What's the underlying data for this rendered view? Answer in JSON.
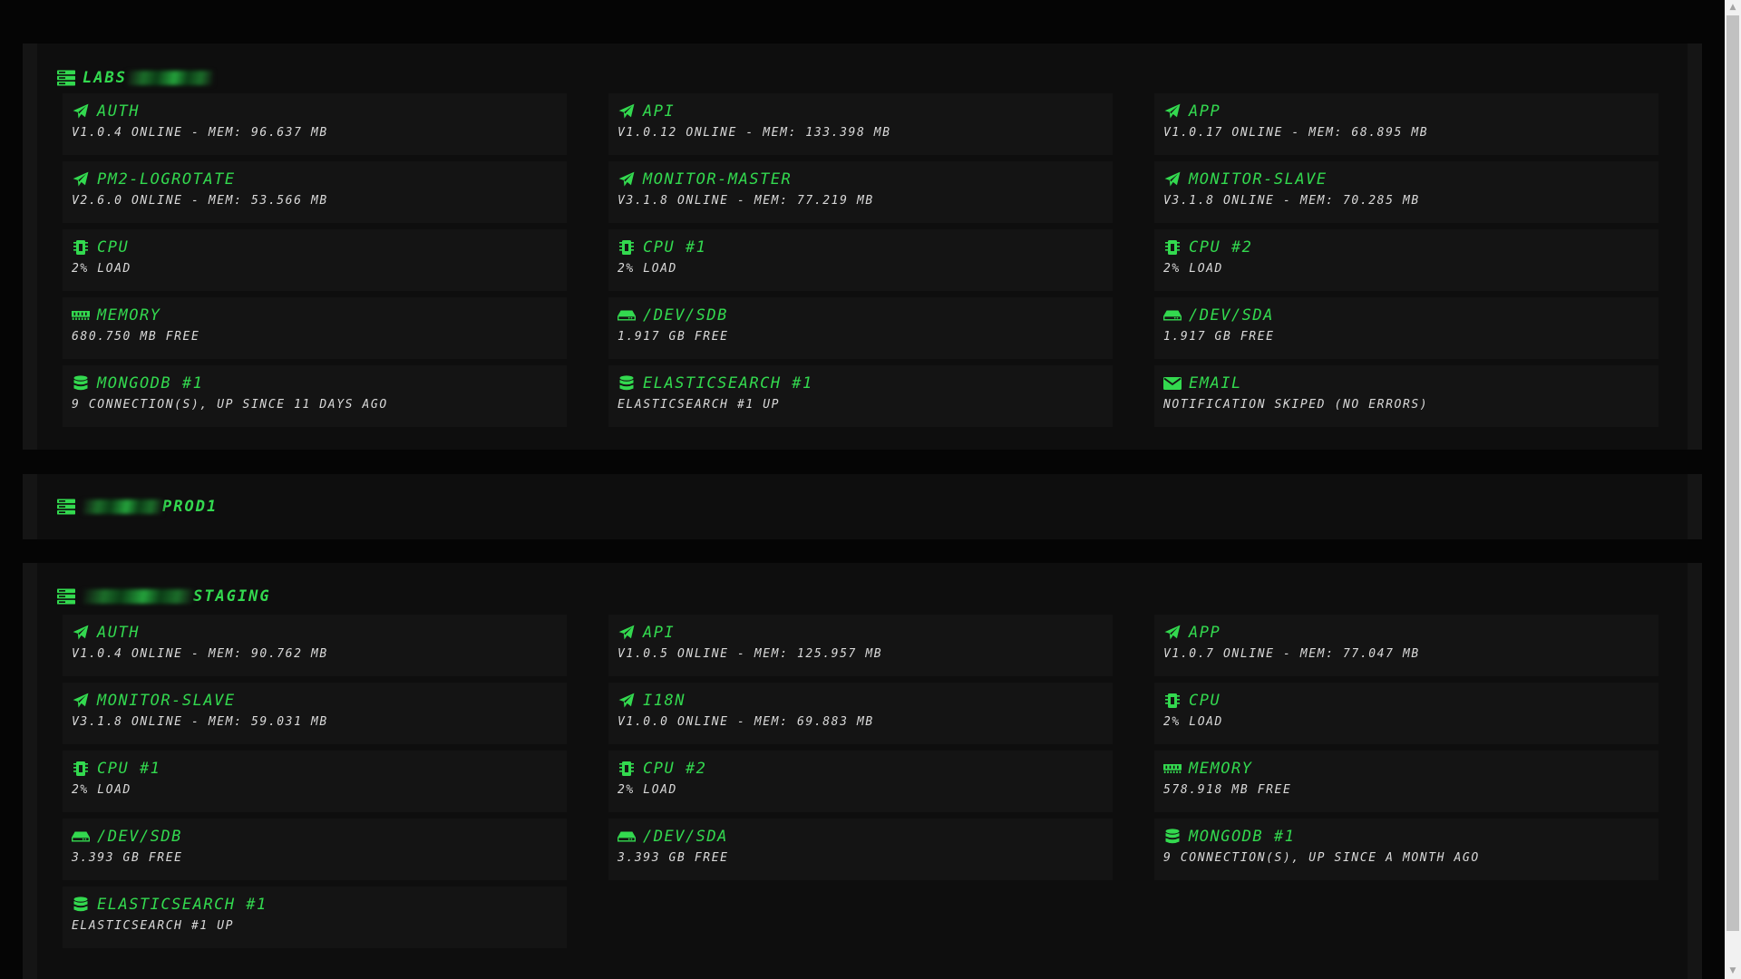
{
  "colors": {
    "accent": "#33d94f",
    "background": "#050505",
    "panel": "#0e0e0e",
    "tile": "#141414",
    "text": "#d9d9d9"
  },
  "groups": [
    {
      "name": "LABS",
      "name_position": "suffix",
      "tiles": [
        {
          "icon": "send-icon",
          "title": "AUTH",
          "subtitle": "V1.0.4 ONLINE - MEM: 96.637 MB"
        },
        {
          "icon": "send-icon",
          "title": "API",
          "subtitle": "V1.0.12 ONLINE - MEM: 133.398 MB"
        },
        {
          "icon": "send-icon",
          "title": "APP",
          "subtitle": "V1.0.17 ONLINE - MEM: 68.895 MB"
        },
        {
          "icon": "send-icon",
          "title": "PM2-LOGROTATE",
          "subtitle": "V2.6.0 ONLINE - MEM: 53.566 MB"
        },
        {
          "icon": "send-icon",
          "title": "MONITOR-MASTER",
          "subtitle": "V3.1.8 ONLINE - MEM: 77.219 MB"
        },
        {
          "icon": "send-icon",
          "title": "MONITOR-SLAVE",
          "subtitle": "V3.1.8 ONLINE - MEM: 70.285 MB"
        },
        {
          "icon": "cpu-icon",
          "title": "CPU",
          "subtitle": "2% LOAD"
        },
        {
          "icon": "cpu-icon",
          "title": "CPU #1",
          "subtitle": "2% LOAD"
        },
        {
          "icon": "cpu-icon",
          "title": "CPU #2",
          "subtitle": "2% LOAD"
        },
        {
          "icon": "memory-icon",
          "title": "MEMORY",
          "subtitle": "680.750 MB FREE"
        },
        {
          "icon": "hdd-icon",
          "title": "/DEV/SDB",
          "subtitle": "1.917 GB FREE"
        },
        {
          "icon": "hdd-icon",
          "title": "/DEV/SDA",
          "subtitle": "1.917 GB FREE"
        },
        {
          "icon": "database-icon",
          "title": "MONGODB #1",
          "subtitle": "9 CONNECTION(S), UP SINCE 11 DAYS AGO"
        },
        {
          "icon": "database-icon",
          "title": "ELASTICSEARCH #1",
          "subtitle": "ELASTICSEARCH #1 UP"
        },
        {
          "icon": "envelope-icon",
          "title": "EMAIL",
          "subtitle": "NOTIFICATION SKIPED (NO ERRORS)"
        }
      ]
    },
    {
      "name": "PROD1",
      "name_position": "prefix",
      "tiles": []
    },
    {
      "name": "STAGING",
      "name_position": "prefix",
      "tiles": [
        {
          "icon": "send-icon",
          "title": "AUTH",
          "subtitle": "V1.0.4 ONLINE - MEM: 90.762 MB"
        },
        {
          "icon": "send-icon",
          "title": "API",
          "subtitle": "V1.0.5 ONLINE - MEM: 125.957 MB"
        },
        {
          "icon": "send-icon",
          "title": "APP",
          "subtitle": "V1.0.7 ONLINE - MEM: 77.047 MB"
        },
        {
          "icon": "send-icon",
          "title": "MONITOR-SLAVE",
          "subtitle": "V3.1.8 ONLINE - MEM: 59.031 MB"
        },
        {
          "icon": "send-icon",
          "title": "I18N",
          "subtitle": "V1.0.0 ONLINE - MEM: 69.883 MB"
        },
        {
          "icon": "cpu-icon",
          "title": "CPU",
          "subtitle": "2% LOAD"
        },
        {
          "icon": "cpu-icon",
          "title": "CPU #1",
          "subtitle": "2% LOAD"
        },
        {
          "icon": "cpu-icon",
          "title": "CPU #2",
          "subtitle": "2% LOAD"
        },
        {
          "icon": "memory-icon",
          "title": "MEMORY",
          "subtitle": "578.918 MB FREE"
        },
        {
          "icon": "hdd-icon",
          "title": "/DEV/SDB",
          "subtitle": "3.393 GB FREE"
        },
        {
          "icon": "hdd-icon",
          "title": "/DEV/SDA",
          "subtitle": "3.393 GB FREE"
        },
        {
          "icon": "database-icon",
          "title": "MONGODB #1",
          "subtitle": "9 CONNECTION(S), UP SINCE A MONTH AGO"
        },
        {
          "icon": "database-icon",
          "title": "ELASTICSEARCH #1",
          "subtitle": "ELASTICSEARCH #1 UP"
        }
      ]
    }
  ]
}
